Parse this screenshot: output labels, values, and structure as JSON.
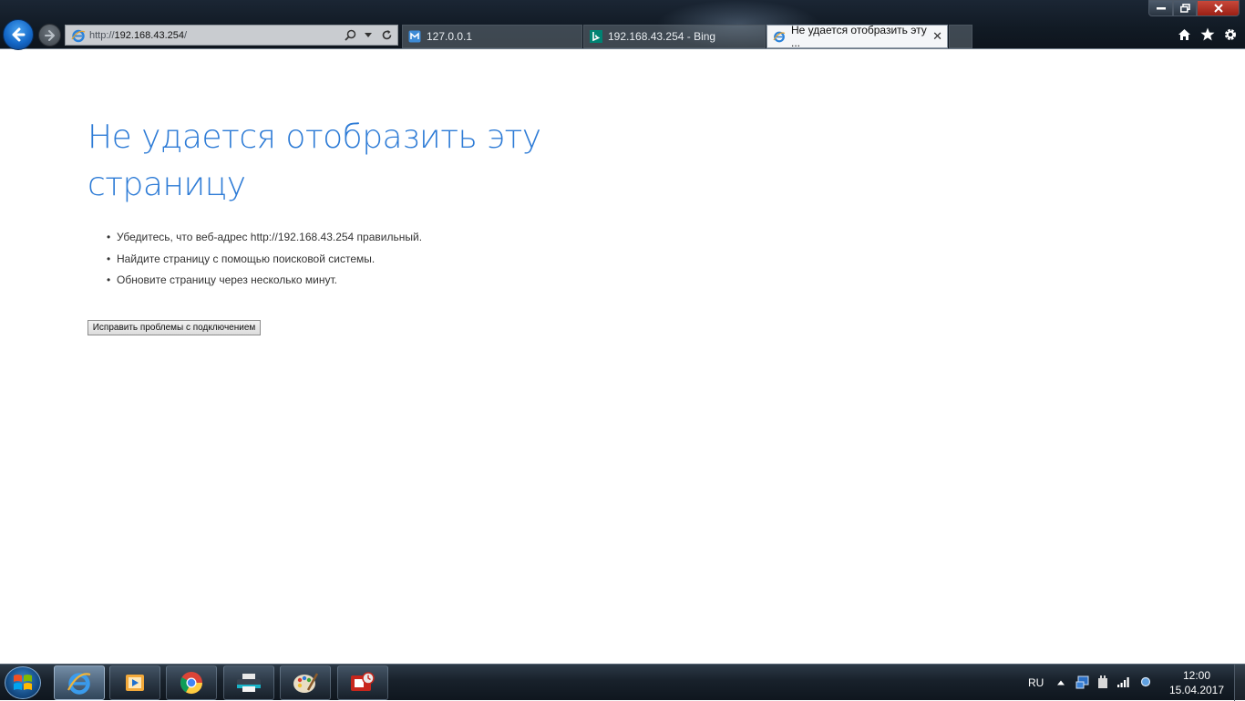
{
  "browser": {
    "address": {
      "prefix": "http://",
      "host": "192.168.43.254",
      "suffix": "/"
    },
    "tabs": [
      {
        "label": "127.0.0.1",
        "icon": "web-page-icon"
      },
      {
        "label": "192.168.43.254 - Bing",
        "icon": "bing-icon"
      },
      {
        "label": "Не удается отобразить эту ...",
        "icon": "ie-icon",
        "active": true
      }
    ]
  },
  "page": {
    "title": "Не удается отобразить эту страницу",
    "bullets": [
      "Убедитесь, что веб-адрес http://192.168.43.254 правильный.",
      "Найдите страницу с помощью поисковой системы.",
      "Обновите страницу через несколько минут."
    ],
    "fix_button": "Исправить проблемы с подключением"
  },
  "taskbar": {
    "language": "RU",
    "time": "12:00",
    "date": "15.04.2017",
    "apps": [
      "internet-explorer",
      "media-player",
      "chrome",
      "printer",
      "paint",
      "app"
    ]
  },
  "colors": {
    "title": "#2d7bd6",
    "chrome_bg": "#111a24",
    "taskbar_bg": "#18212b"
  }
}
